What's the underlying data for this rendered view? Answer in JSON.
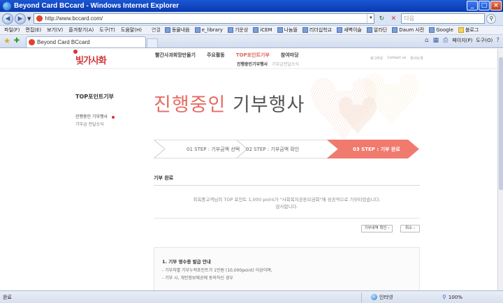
{
  "window": {
    "title": "Beyond Card BCcard - Windows Internet Explorer",
    "min_glyph": "_",
    "max_glyph": "□",
    "close_glyph": "×"
  },
  "addressbar": {
    "back_glyph": "◀",
    "forward_glyph": "▶",
    "url": "http://www.bccard.com/",
    "dropdown_glyph": "▼",
    "refresh_glyph": "↻",
    "stop_glyph": "✕",
    "search_placeholder": "다음",
    "search_go_glyph": "⚲"
  },
  "menu": [
    "파일(F)",
    "편집(E)",
    "보기(V)",
    "즐겨찾기(A)",
    "도구(T)",
    "도움말(H)"
  ],
  "links_label": "연결",
  "links": [
    {
      "label": "동물내음",
      "folder": false
    },
    {
      "label": "e_library",
      "folder": false
    },
    {
      "label": "기운상",
      "folder": false
    },
    {
      "label": "iCEM",
      "folder": false
    },
    {
      "label": "나눔뜰",
      "folder": false
    },
    {
      "label": "리더십학교",
      "folder": false
    },
    {
      "label": "새벽이슬",
      "folder": false
    },
    {
      "label": "알라딘",
      "folder": false
    },
    {
      "label": "Daum 사전",
      "folder": false
    },
    {
      "label": "Google",
      "folder": false
    },
    {
      "label": "블로그",
      "folder": true
    }
  ],
  "tab": {
    "label": "Beyond Card BCcard",
    "fav_glyph": "★",
    "add_fav_glyph": "✚"
  },
  "tabtools": {
    "home_glyph": "⌂",
    "feed_glyph": "▦",
    "print_glyph": "⎙",
    "page_label": "페이지(P)",
    "tools_label": "도구(O)",
    "help_glyph": "?"
  },
  "site": {
    "logo_text": "빛가사화",
    "gnb": [
      {
        "label": "빨간사과희망만들기",
        "active": false
      },
      {
        "label": "주요활동",
        "active": false
      },
      {
        "label": "TOP포인트기부",
        "active": true
      },
      {
        "label": "참여마당",
        "active": false
      }
    ],
    "subnav": {
      "current": "진행중인기부행사",
      "other": "기부금전달소식"
    },
    "util": [
      "로그아웃",
      "Contact us",
      "회사소개"
    ],
    "lnb": {
      "title": "TOP포인트기부",
      "item1": "진행중인 기부행사",
      "item2": "기부금 전달소식"
    },
    "title_red": "진행중인",
    "title_dark": "기부행사",
    "steps": [
      {
        "label": "01 STEP : 기부금액 선택",
        "active": false
      },
      {
        "label": "02 STEP : 기부금액 확인",
        "active": false
      },
      {
        "label": "03 STEP : 기부 완료",
        "active": true
      }
    ],
    "section_title": "기부 완료",
    "notice_line1": "최옥중고객님의 TOP 포인트 1,000 point가 \"사회복지공동모금회\"에 성공적으로 기부되었습니다.",
    "notice_line2": "감사합니다.",
    "btn_history": "기부내역 확인 ›",
    "btn_cancel": "취소 ›",
    "receipt": {
      "title": "1. 기부 영수증 발급 안내",
      "line1": "- 기부처별 기부누적포인트가 1만원 (10,000point) 이상이며,",
      "line2": "- 기부 시, 개인정보제공에 동의하신 경우"
    }
  },
  "status": {
    "text": "완료",
    "zone": "인터넷",
    "zoom": "100%"
  },
  "colors": {
    "brand_red": "#d2353a",
    "accent_salmon": "#e56c63",
    "step_active": "#f07a6e"
  }
}
